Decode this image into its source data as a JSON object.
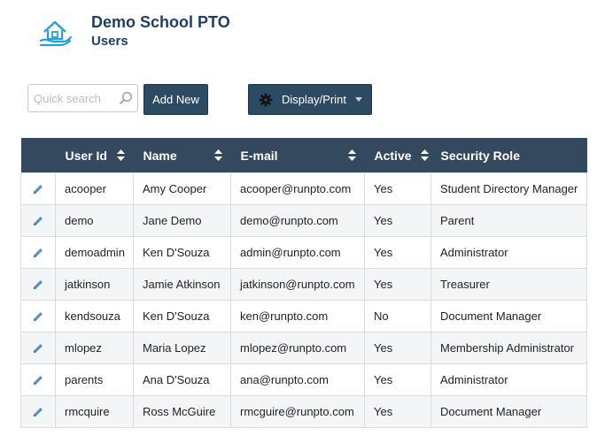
{
  "header": {
    "org_title": "Demo School PTO",
    "page_subtitle": "Users",
    "logo_icon": "house-hand-icon"
  },
  "toolbar": {
    "search_placeholder": "Quick search",
    "search_value": "",
    "add_new_label": "Add New",
    "display_print_label": "Display/Print"
  },
  "colors": {
    "brand_dark": "#1f3e64",
    "header_bg": "#34495e",
    "button_bg": "#2d4a63",
    "icon_accent": "#2a9fd6",
    "edit_icon": "#5a8fbf"
  },
  "table": {
    "columns": [
      "User Id",
      "Name",
      "E-mail",
      "Active",
      "Security Role"
    ],
    "rows": [
      {
        "user_id": "acooper",
        "name": "Amy Cooper",
        "email": "acooper@runpto.com",
        "active": "Yes",
        "role": "Student Directory Manager"
      },
      {
        "user_id": "demo",
        "name": "Jane Demo",
        "email": "demo@runpto.com",
        "active": "Yes",
        "role": "Parent"
      },
      {
        "user_id": "demoadmin",
        "name": "Ken D'Souza",
        "email": "admin@runpto.com",
        "active": "Yes",
        "role": "Administrator"
      },
      {
        "user_id": "jatkinson",
        "name": "Jamie Atkinson",
        "email": "jatkinson@runpto.com",
        "active": "Yes",
        "role": "Treasurer"
      },
      {
        "user_id": "kendsouza",
        "name": "Ken D'Souza",
        "email": "ken@runpto.com",
        "active": "No",
        "role": "Document Manager"
      },
      {
        "user_id": "mlopez",
        "name": "Maria Lopez",
        "email": "mlopez@runpto.com",
        "active": "Yes",
        "role": "Membership Administrator"
      },
      {
        "user_id": "parents",
        "name": "Ana D'Souza",
        "email": "ana@runpto.com",
        "active": "Yes",
        "role": "Administrator"
      },
      {
        "user_id": "rmcquire",
        "name": "Ross McGuire",
        "email": "rmcguire@runpto.com",
        "active": "Yes",
        "role": "Document Manager"
      }
    ]
  }
}
